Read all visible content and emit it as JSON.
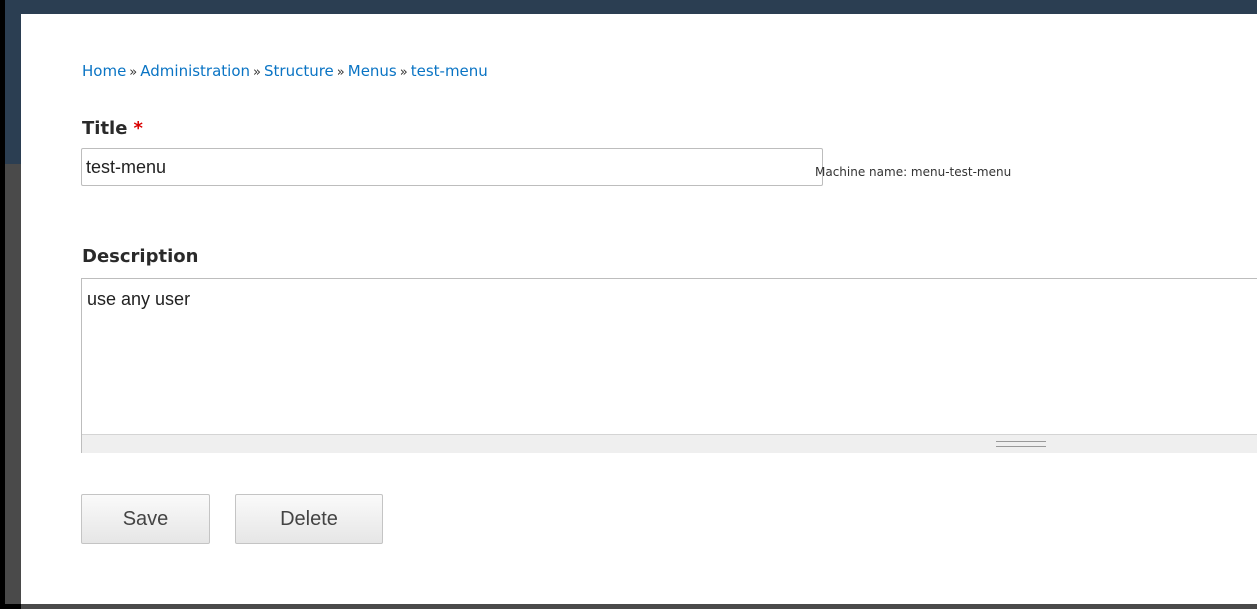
{
  "breadcrumb": {
    "items": [
      "Home",
      "Administration",
      "Structure",
      "Menus",
      "test-menu"
    ],
    "separator": "»"
  },
  "form": {
    "title_label": "Title",
    "required_mark": "*",
    "title_value": "test-menu",
    "machine_name": "Machine name: menu-test-menu",
    "description_label": "Description",
    "description_value": "use any user"
  },
  "actions": {
    "save_label": "Save",
    "delete_label": "Delete"
  },
  "colors": {
    "link": "#0a74c4",
    "required": "#d90000"
  }
}
